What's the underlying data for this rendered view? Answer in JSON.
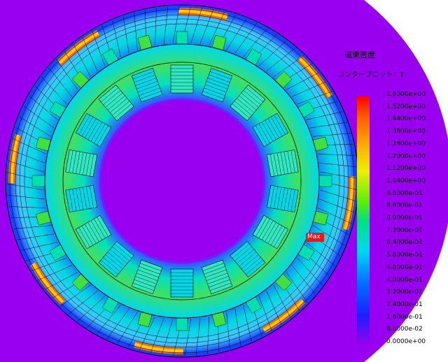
{
  "legend": {
    "title": "磁束密度",
    "subtitle": "コンタープロット：T",
    "ticks": [
      "1.6000e+00",
      "1.5200e+00",
      "1.4400e+00",
      "1.3600e+00",
      "1.2800e+00",
      "1.2000e+00",
      "1.1200e+00",
      "1.0400e+00",
      "9.6000e-01",
      "8.8000e-01",
      "8.0000e-01",
      "7.2000e-01",
      "6.4000e-01",
      "5.6000e-01",
      "4.8000e-01",
      "4.0000e-01",
      "3.2000e-01",
      "2.4000e-01",
      "1.6000e-01",
      "8.0000e-02",
      "0.0000e+00"
    ],
    "colors": [
      "#ff0000",
      "#ff4400",
      "#ff7a00",
      "#ffaa00",
      "#ffd200",
      "#f2f000",
      "#c8f000",
      "#8ef000",
      "#4cf000",
      "#18e818",
      "#00e070",
      "#00e0b0",
      "#00d8e8",
      "#00b8ff",
      "#0090ff",
      "#0066ff",
      "#0040ff",
      "#1a1aff",
      "#3a10f0",
      "#6a10e8",
      "#9a00f0"
    ]
  },
  "max_marker": {
    "label": "Max"
  },
  "colors": {
    "background": "#9a00f0",
    "outer_region": "#ffffff"
  }
}
